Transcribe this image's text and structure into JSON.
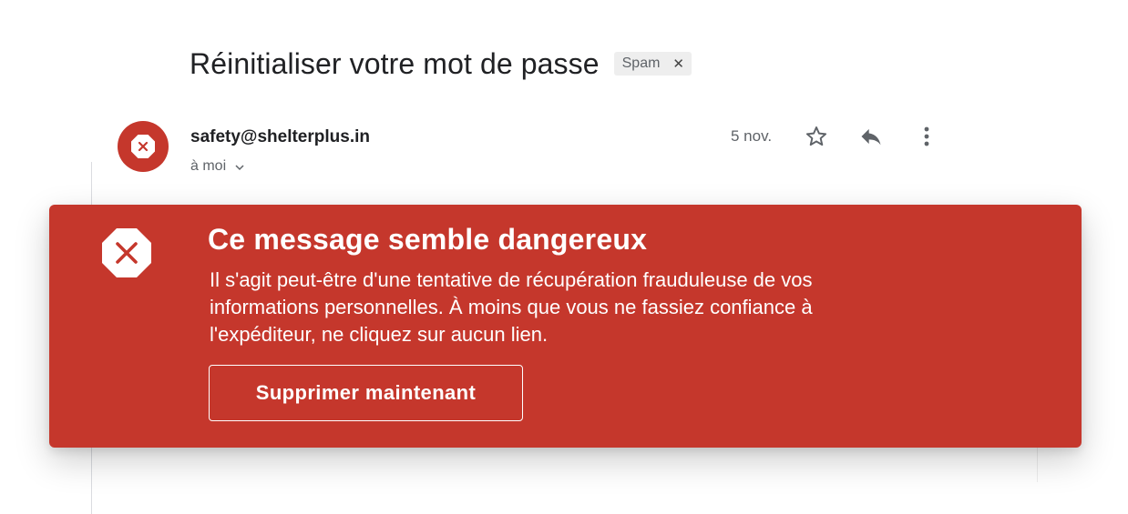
{
  "email": {
    "subject": "Réinitialiser votre mot de passe",
    "label_chip": {
      "label": "Spam",
      "remove_glyph": "✕"
    },
    "sender": "safety@shelterplus.in",
    "recipient": "à moi",
    "date": "5 nov.",
    "actions": [
      "star-icon",
      "reply-icon",
      "more-vert-icon"
    ]
  },
  "warning": {
    "title": "Ce message semble dangereux",
    "body": "Il s'agit peut-être d'une tentative de récupération frauduleuse de vos informations personnelles. À moins que vous ne fassiez confiance à l'expéditeur, ne cliquez sur aucun lien.",
    "button_label": "Supprimer maintenant"
  },
  "colors": {
    "danger": "#c5372c",
    "text_primary": "#202124",
    "text_secondary": "#5f6368",
    "chip_bg": "#eeeeee"
  }
}
